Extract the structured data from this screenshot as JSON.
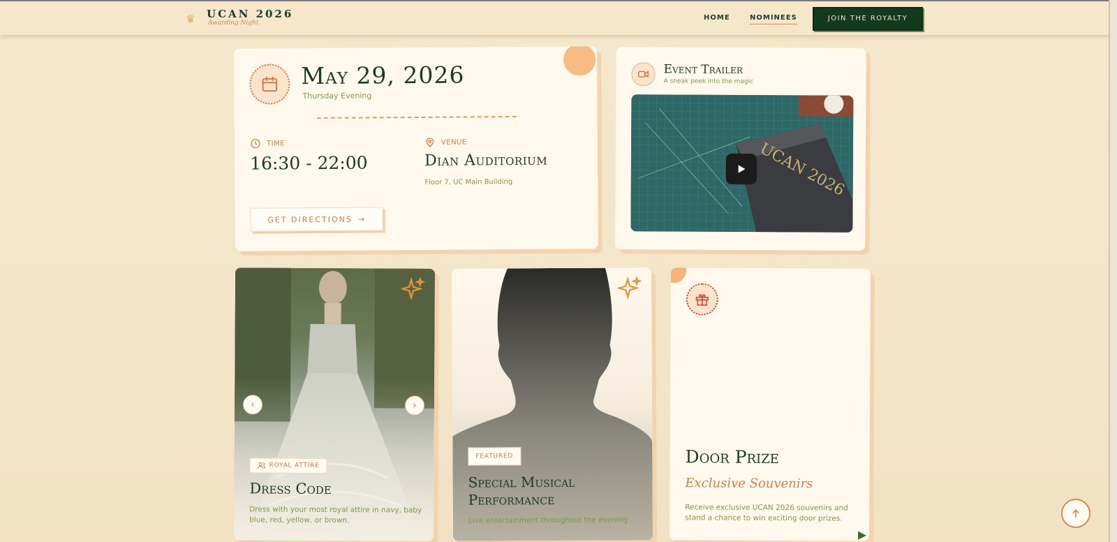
{
  "header": {
    "logo_title": "UCAN 2026",
    "logo_subtitle": "Awarding Night",
    "nav": [
      "HOME",
      "NOMINEES"
    ],
    "cta_label": "JOIN THE ROYALTY"
  },
  "date_card": {
    "date": "May 29, 2026",
    "day": "Thursday Evening",
    "time_label": "TIME",
    "time_value": "16:30 - 22:00",
    "venue_label": "VENUE",
    "venue_value": "Dian Auditorium",
    "venue_detail": "Floor 7, UC Main Building",
    "directions_label": "GET DIRECTIONS"
  },
  "trailer_card": {
    "title": "Event Trailer",
    "subtitle": "A sneak peek into the magic",
    "book_text": "UCAN 2026"
  },
  "dress_card": {
    "badge": "ROYAL ATTIRE",
    "title": "Dress Code",
    "description": "Dress with your most royal attire in navy, baby blue, red, yellow, or brown."
  },
  "music_card": {
    "badge": "FEATURED",
    "title": "Special Musical Performance",
    "description": "Live entertainment throughout the evening"
  },
  "prize_card": {
    "title": "Door Prize",
    "subtitle": "Exclusive Souvenirs",
    "description": "Receive exclusive UCAN 2026 souvenirs and stand a chance to win exciting door prizes."
  },
  "colors": {
    "background": "#f4e5ca",
    "primary_green": "#123a1c",
    "accent_orange": "#d07a48",
    "text_green": "#7c9a4c"
  }
}
